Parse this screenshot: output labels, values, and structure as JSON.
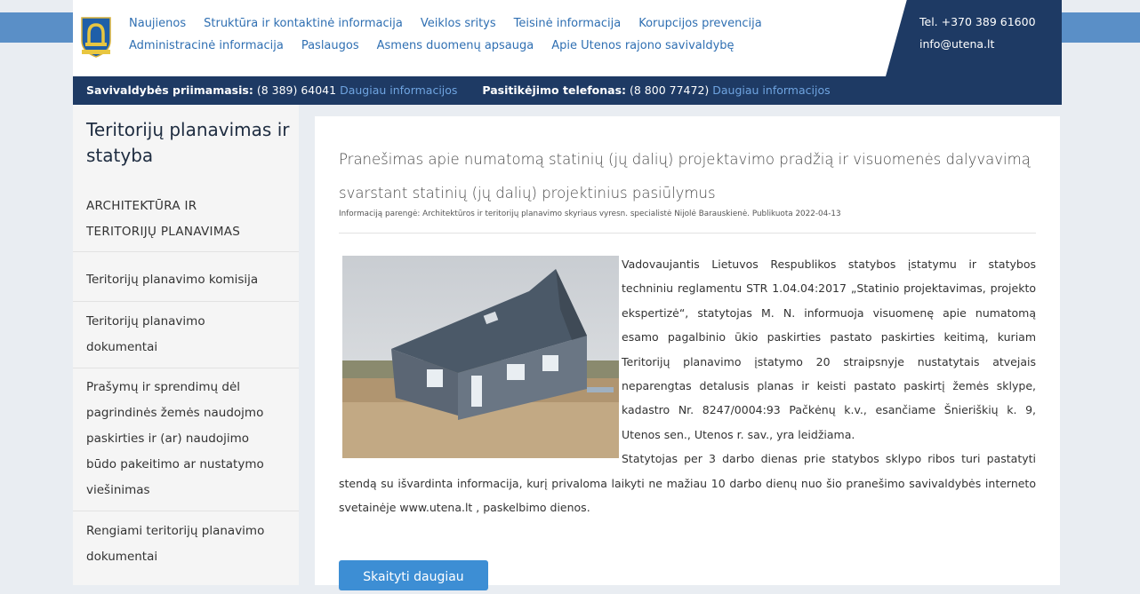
{
  "nav": {
    "row1": [
      "Naujienos",
      "Struktūra ir kontaktinė informacija",
      "Veiklos sritys",
      "Teisinė informacija",
      "Korupcijos prevencija"
    ],
    "row2": [
      "Administracinė informacija",
      "Paslaugos",
      "Asmens duomenų apsauga",
      "Apie Utenos rajono savivaldybę"
    ]
  },
  "contact": {
    "phone": "Tel. +370 389 61600",
    "email": "info@utena.lt"
  },
  "infobar": {
    "reception_label": "Savivaldybės priimamasis:",
    "reception_phone": "(8 389) 64041",
    "reception_link": "Daugiau informacijos",
    "trust_label": "Pasitikėjimo telefonas:",
    "trust_phone": "(8 800 77472)",
    "trust_link": "Daugiau informacijos"
  },
  "sidebar": {
    "title": "Teritorijų planavimas ir statyba",
    "heading": "ARCHITEKTŪRA IR TERITORIJŲ PLANAVIMAS",
    "items": [
      "Teritorijų planavimo komisija",
      "Teritorijų planavimo dokumentai",
      "Prašymų ir sprendimų dėl pagrindinės žemės naudojmo paskirties ir (ar) naudojimo būdo pakeitimo ar nustatymo viešinimas",
      "Rengiami teritorijų planavimo dokumentai"
    ]
  },
  "article": {
    "title": "Pranešimas apie numatomą statinių (jų dalių) projektavimo pradžią ir visuomenės dalyvavimą svarstant statinių (jų dalių) projektinius pasiūlymus",
    "meta": "Informaciją parengė: Architektūros ir teritorijų planavimo skyriaus vyresn. specialistė Nijolė Barauskienė. Publikuota 2022-04-13",
    "paragraph1": "Vadovaujantis Lietuvos Respublikos statybos įstatymu ir statybos techniniu reglamentu STR 1.04.04:2017 „Statinio projektavimas, projekto ekspertizė“, statytojas M. N. informuoja visuomenę apie numatomą esamo pagalbinio ūkio paskirties pastato paskirties keitimą, kuriam Teritorijų planavimo įstatymo 20 straipsnyje nustatytais atvejais neparengtas detalusis planas ir keisti pastato paskirtį žemės sklype, kadastro Nr. 8247/0004:93 Pačkėnų k.v., esančiame Šnieriškių k. 9, Utenos sen., Utenos r. sav., yra leidžiama.",
    "paragraph2": "Statytojas per 3 darbo dienas prie statybos sklypo ribos turi pastatyti stendą su išvardinta informacija, kurį privaloma laikyti ne mažiau 10 darbo dienų nuo šio pranešimo savivaldybės interneto svetainėje www.utena.lt , paskelbimo dienos.",
    "read_more": "Skaityti daugiau"
  }
}
